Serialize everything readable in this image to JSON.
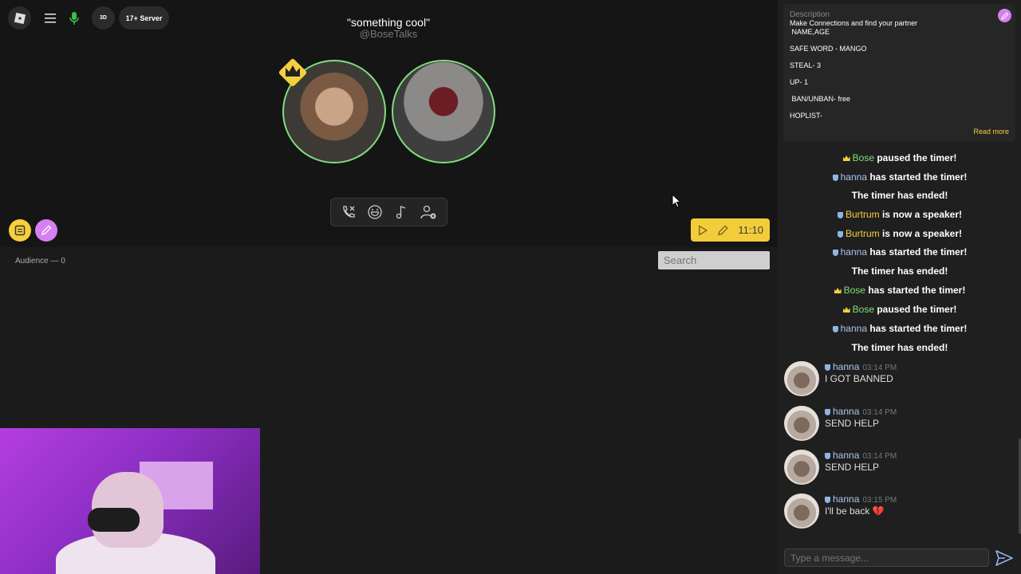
{
  "topbar": {
    "threeD_label": "3D",
    "server_label": "17+ Server"
  },
  "room": {
    "title": "\"something cool\"",
    "host": "@BoseTalks"
  },
  "timer": {
    "value": "11:10"
  },
  "audience": {
    "label": "Audience — 0"
  },
  "search": {
    "placeholder": "Search"
  },
  "description": {
    "label": "Description",
    "lines": [
      "Make Connections and find your partner",
      " NAME,AGE",
      "",
      "SAFE WORD - MANGO",
      "",
      "STEAL- 3",
      "",
      "UP- 1",
      "",
      " BAN/UNBAN- free",
      "",
      "HOPLIST-"
    ],
    "read_more": "Read more"
  },
  "events": [
    {
      "badge": "crown",
      "name": "Bose",
      "name_color": "g",
      "text": " paused the timer!"
    },
    {
      "badge": "shield",
      "name": "hanna",
      "name_color": "b",
      "text": " has started the timer!"
    },
    {
      "badge": "",
      "name": "",
      "name_color": "",
      "text": "The timer has ended!"
    },
    {
      "badge": "shield",
      "name": "Burtrum",
      "name_color": "y",
      "text": " is now a speaker!"
    },
    {
      "badge": "shield",
      "name": "Burtrum",
      "name_color": "y",
      "text": " is now a speaker!"
    },
    {
      "badge": "shield",
      "name": "hanna",
      "name_color": "b",
      "text": " has started the timer!"
    },
    {
      "badge": "",
      "name": "",
      "name_color": "",
      "text": "The timer has ended!"
    },
    {
      "badge": "crown",
      "name": "Bose",
      "name_color": "g",
      "text": " has started the timer!"
    },
    {
      "badge": "crown",
      "name": "Bose",
      "name_color": "g",
      "text": " paused the timer!"
    },
    {
      "badge": "shield",
      "name": "hanna",
      "name_color": "b",
      "text": " has started the timer!"
    },
    {
      "badge": "",
      "name": "",
      "name_color": "",
      "text": "The timer has ended!"
    }
  ],
  "messages": [
    {
      "user": "hanna",
      "time": "03:14 PM",
      "text": "I GOT BANNED",
      "heart": ""
    },
    {
      "user": "hanna",
      "time": "03:14 PM",
      "text": "SEND HELP",
      "heart": ""
    },
    {
      "user": "hanna",
      "time": "03:14 PM",
      "text": "SEND HELP",
      "heart": ""
    },
    {
      "user": "hanna",
      "time": "03:15 PM",
      "text": "I'll be back ",
      "heart": "💔"
    }
  ],
  "composer": {
    "placeholder": "Type a message..."
  },
  "colors": {
    "accent_yellow": "#f5cf3c",
    "accent_purple": "#d67ff1",
    "speaker_ring": "#7ee07a"
  },
  "icons": [
    "roblox-logo-icon",
    "hamburger-menu-icon",
    "microphone-icon",
    "crown-icon",
    "notes-icon",
    "pencil-icon",
    "call-end-icon",
    "emoji-icon",
    "music-note-icon",
    "add-user-icon",
    "play-icon",
    "send-icon",
    "shield-icon"
  ]
}
